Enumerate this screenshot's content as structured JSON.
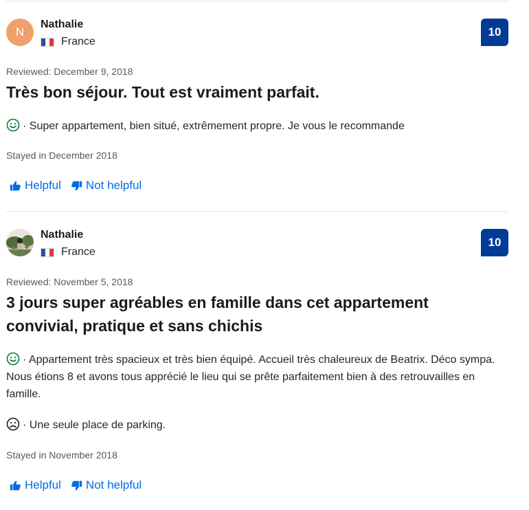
{
  "reviews": [
    {
      "reviewer_name": "Nathalie",
      "avatar_initial": "N",
      "avatar_color": "#f0a06c",
      "country": "France",
      "score": "10",
      "reviewed_date": "Reviewed: December 9, 2018",
      "title": "Très bon séjour. Tout est vraiment parfait.",
      "positive": "· Super appartement, bien situé, extrêmement propre. Je vous le recommande",
      "stayed": "Stayed in December 2018",
      "helpful_label": "Helpful",
      "not_helpful_label": "Not helpful"
    },
    {
      "reviewer_name": "Nathalie",
      "country": "France",
      "score": "10",
      "reviewed_date": "Reviewed: November 5, 2018",
      "title": "3 jours super agréables en famille dans cet appartement convivial, pratique et sans chichis",
      "positive": "· Appartement très spacieux et très bien équipé. Accueil très chaleureux de Beatrix. Déco sympa. Nous étions 8 et avons tous apprécié le lieu qui se prête parfaitement bien à des retrouvailles en famille.",
      "negative": "· Une seule place de parking.",
      "stayed": "Stayed in November 2018",
      "helpful_label": "Helpful",
      "not_helpful_label": "Not helpful"
    }
  ],
  "colors": {
    "score_badge": "#003b95",
    "link": "#006ce4",
    "positive_icon": "#008234",
    "negative_icon": "#1a1a1a"
  },
  "icons": [
    "flag-france-icon",
    "smile-icon",
    "frown-icon",
    "thumbs-up-icon",
    "thumbs-down-icon"
  ]
}
